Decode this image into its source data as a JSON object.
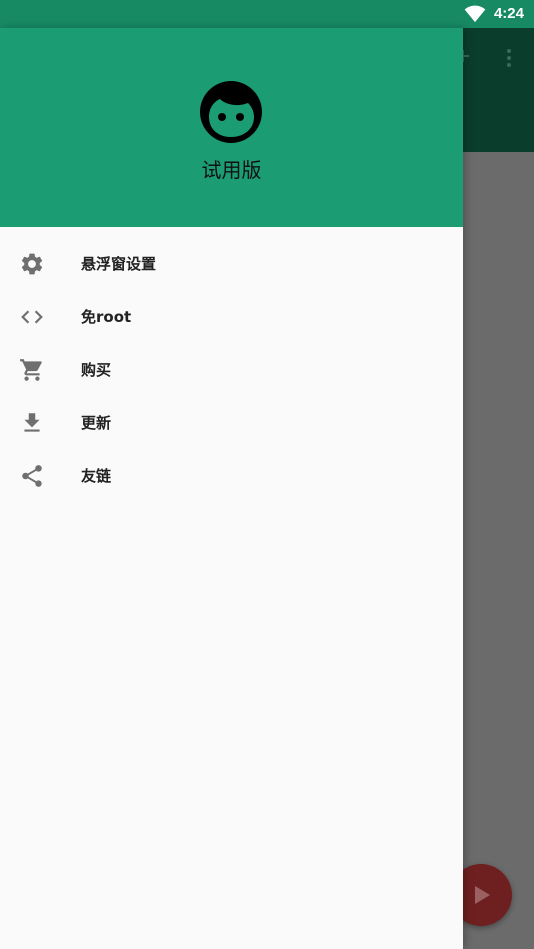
{
  "status_bar": {
    "time": "4:24"
  },
  "drawer": {
    "header_title": "试用版",
    "items": [
      {
        "label": "悬浮窗设置",
        "icon": "gear-icon"
      },
      {
        "label": "免root",
        "icon": "code-icon"
      },
      {
        "label": "购买",
        "icon": "cart-icon"
      },
      {
        "label": "更新",
        "icon": "download-icon"
      },
      {
        "label": "友链",
        "icon": "share-icon"
      }
    ]
  },
  "colors": {
    "status_bar": "#178a63",
    "header": "#1b9c73",
    "drawer_bg": "#fafafa",
    "icon": "#6f6f6f",
    "fab": "#6e2020"
  }
}
